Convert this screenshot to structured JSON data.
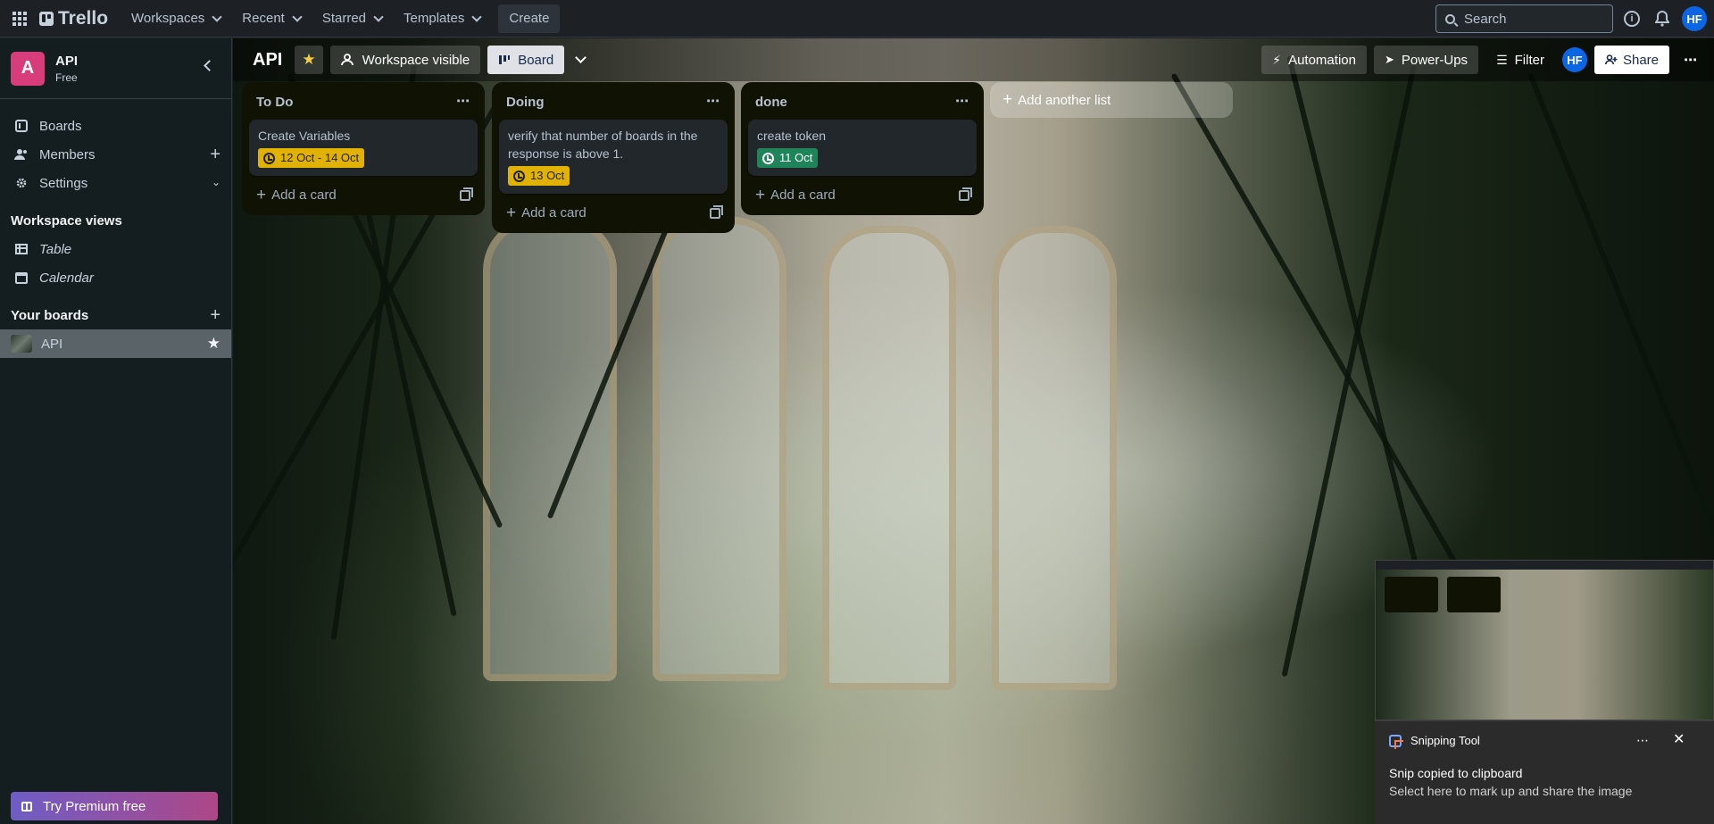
{
  "topnav": {
    "logo_text": "Trello",
    "menus": [
      "Workspaces",
      "Recent",
      "Starred",
      "Templates"
    ],
    "create_label": "Create",
    "search_placeholder": "Search",
    "avatar_initials": "HF"
  },
  "sidebar": {
    "workspace_initial": "A",
    "workspace_name": "API",
    "workspace_plan": "Free",
    "items": [
      {
        "label": "Boards",
        "icon": "trello-board-icon"
      },
      {
        "label": "Members",
        "icon": "members-icon"
      },
      {
        "label": "Settings",
        "icon": "gear-icon"
      }
    ],
    "views_heading": "Workspace views",
    "views": [
      {
        "label": "Table",
        "icon": "table-icon"
      },
      {
        "label": "Calendar",
        "icon": "calendar-icon"
      }
    ],
    "boards_heading": "Your boards",
    "boards": [
      {
        "label": "API",
        "starred": true
      }
    ],
    "premium_label": "Try Premium free"
  },
  "board": {
    "title": "API",
    "visibility_label": "Workspace visible",
    "view_label": "Board",
    "automation_label": "Automation",
    "powerups_label": "Power-Ups",
    "filter_label": "Filter",
    "member_initials": "HF",
    "share_label": "Share",
    "add_list_label": "Add another list",
    "add_card_label": "Add a card",
    "lists": [
      {
        "title": "To Do",
        "cards": [
          {
            "title": "Create Variables",
            "due": "12 Oct - 14 Oct",
            "due_color": "#e2b203"
          }
        ]
      },
      {
        "title": "Doing",
        "cards": [
          {
            "title": "verify that number of boards in the response is above 1.",
            "due": "13 Oct",
            "due_color": "#e2b203"
          }
        ]
      },
      {
        "title": "done",
        "cards": [
          {
            "title": "create token",
            "due": "11 Oct",
            "due_color": "#1f845a"
          }
        ]
      }
    ]
  },
  "toast": {
    "app_name": "Snipping Tool",
    "title": "Snip copied to clipboard",
    "subtitle": "Select here to mark up and share the image"
  },
  "colors": {
    "accent": "#0c66e4",
    "workspace_tile": "#d63d7a",
    "star": "#f5cd47"
  }
}
